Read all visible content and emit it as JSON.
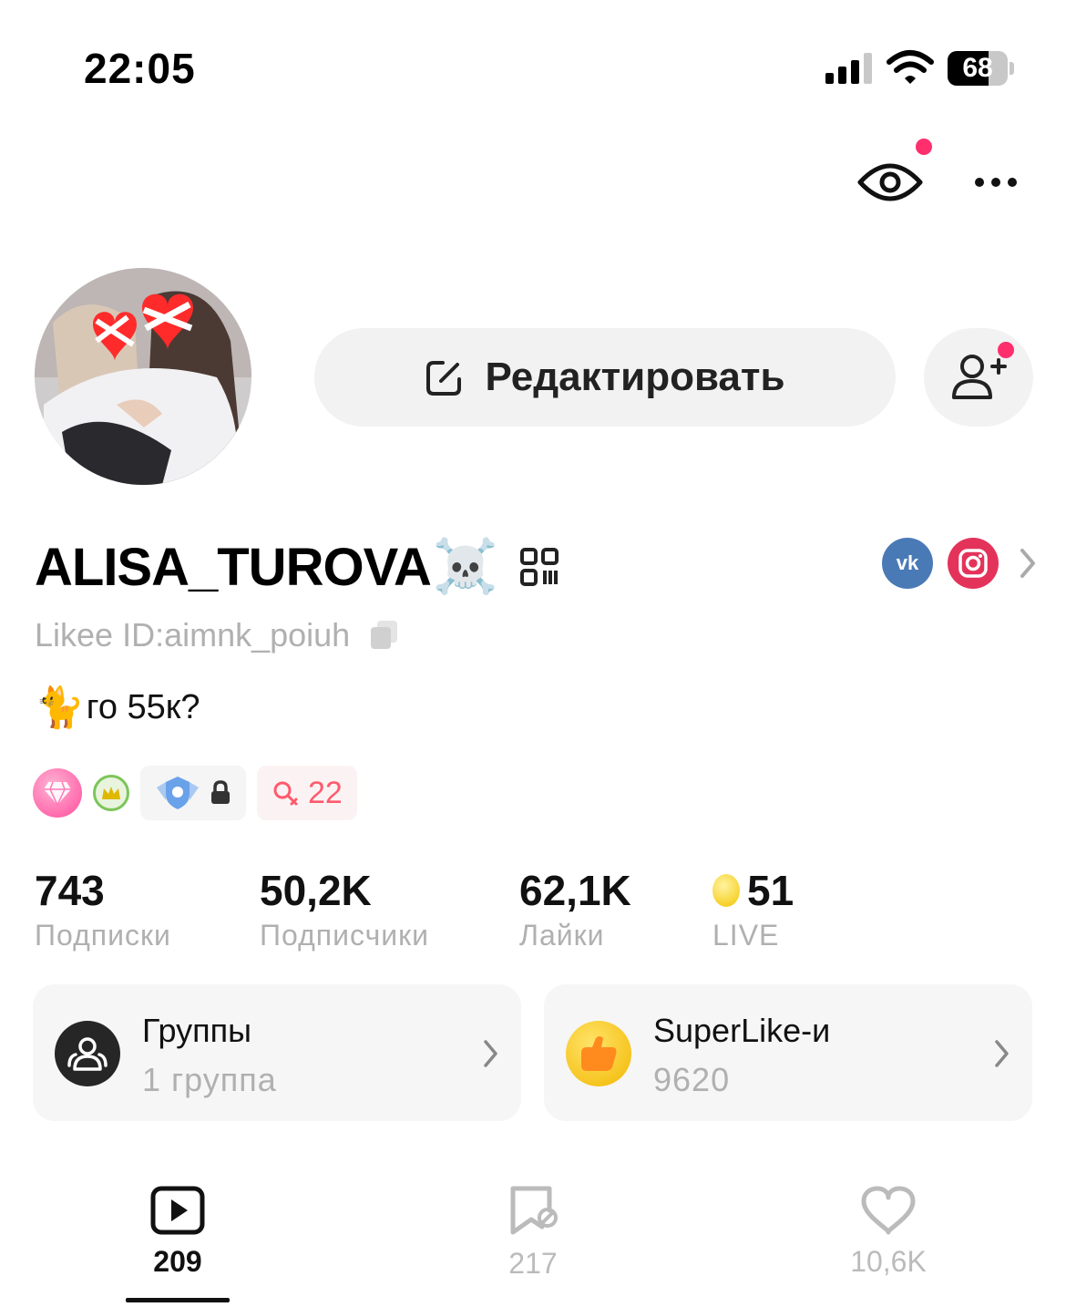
{
  "status_bar": {
    "time": "22:05",
    "battery_level": "68",
    "battery_fraction": 0.68
  },
  "profile": {
    "username": "ALISA_TUROVA",
    "username_emoji": "☠️",
    "likee_id": "Likee ID:aimnk_poiuh",
    "bio_emoji": "🐈",
    "bio": "го 55к?"
  },
  "actions": {
    "edit_label": "Редактировать"
  },
  "social": {
    "vk_label": "vk"
  },
  "badges": {
    "level": "22"
  },
  "stats": [
    {
      "value": "743",
      "label": "Подписки"
    },
    {
      "value": "50,2K",
      "label": "Подписчики"
    },
    {
      "value": "62,1K",
      "label": "Лайки"
    },
    {
      "value": "51",
      "label": "LIVE"
    }
  ],
  "cards": {
    "groups": {
      "title": "Группы",
      "subtitle": "1 группа"
    },
    "superlikes": {
      "title": "SuperLike-и",
      "subtitle": "9620"
    }
  },
  "tabs": [
    {
      "icon": "video-play-icon",
      "count": "209",
      "active": true
    },
    {
      "icon": "bookmark-icon",
      "count": "217",
      "active": false
    },
    {
      "icon": "heart-icon",
      "count": "10,6K",
      "active": false
    }
  ],
  "colors": {
    "accent_dot": "#ff2f6d",
    "muted_text": "#b0b0b0",
    "vk": "#4a7ab6",
    "instagram": "#e4335a"
  }
}
